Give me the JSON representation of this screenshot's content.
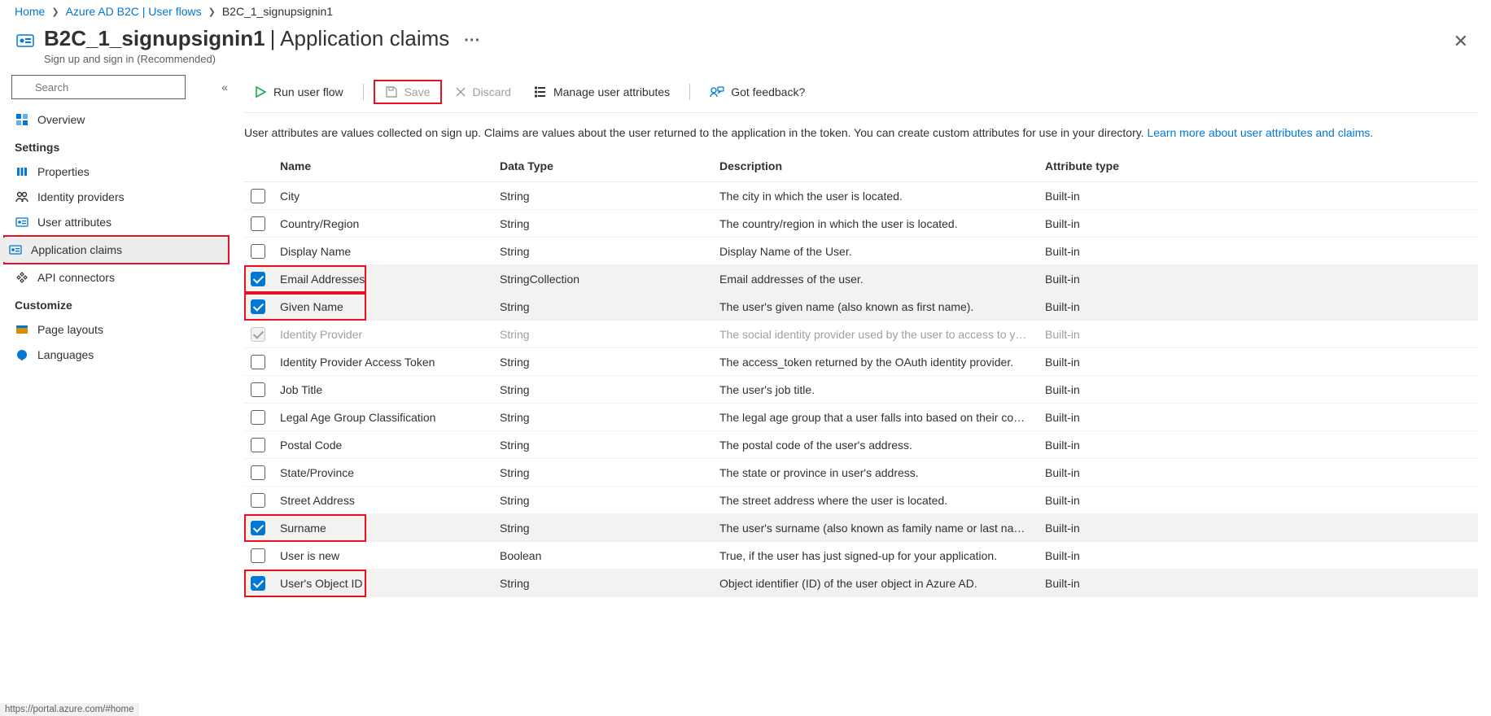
{
  "breadcrumb": {
    "items": [
      "Home",
      "Azure AD B2C | User flows",
      "B2C_1_signupsignin1"
    ]
  },
  "header": {
    "icon_name": "user-flow-icon",
    "title_strong": "B2C_1_signupsignin1",
    "title_sep": " | ",
    "title_thin": "Application claims",
    "ellipsis": "···",
    "subtitle": "Sign up and sign in (Recommended)"
  },
  "sidebar": {
    "search_placeholder": "Search",
    "overview_label": "Overview",
    "groups": [
      {
        "label": "Settings",
        "items": [
          {
            "icon": "properties-icon",
            "label": "Properties"
          },
          {
            "icon": "identity-providers-icon",
            "label": "Identity providers"
          },
          {
            "icon": "user-attributes-icon",
            "label": "User attributes"
          },
          {
            "icon": "application-claims-icon",
            "label": "Application claims",
            "active": true,
            "highlight": true
          },
          {
            "icon": "api-connectors-icon",
            "label": "API connectors"
          }
        ]
      },
      {
        "label": "Customize",
        "items": [
          {
            "icon": "page-layouts-icon",
            "label": "Page layouts"
          },
          {
            "icon": "languages-icon",
            "label": "Languages"
          }
        ]
      }
    ]
  },
  "toolbar": {
    "run_label": "Run user flow",
    "save_label": "Save",
    "discard_label": "Discard",
    "manage_label": "Manage user attributes",
    "feedback_label": "Got feedback?"
  },
  "info": {
    "text": "User attributes are values collected on sign up. Claims are values about the user returned to the application in the token. You can create custom attributes for use in your directory. ",
    "link": "Learn more about user attributes and claims."
  },
  "table": {
    "columns": [
      "Name",
      "Data Type",
      "Description",
      "Attribute type"
    ],
    "rows": [
      {
        "checked": false,
        "name": "City",
        "type": "String",
        "desc": "The city in which the user is located.",
        "attr": "Built-in"
      },
      {
        "checked": false,
        "name": "Country/Region",
        "type": "String",
        "desc": "The country/region in which the user is located.",
        "attr": "Built-in"
      },
      {
        "checked": false,
        "name": "Display Name",
        "type": "String",
        "desc": "Display Name of the User.",
        "attr": "Built-in"
      },
      {
        "checked": true,
        "highlight": true,
        "name": "Email Addresses",
        "type": "StringCollection",
        "desc": "Email addresses of the user.",
        "attr": "Built-in"
      },
      {
        "checked": true,
        "highlight": true,
        "name": "Given Name",
        "type": "String",
        "desc": "The user's given name (also known as first name).",
        "attr": "Built-in"
      },
      {
        "disabled": true,
        "name": "Identity Provider",
        "type": "String",
        "desc": "The social identity provider used by the user to access to yo…",
        "attr": "Built-in"
      },
      {
        "checked": false,
        "name": "Identity Provider Access Token",
        "type": "String",
        "desc": "The access_token returned by the OAuth identity provider.",
        "attr": "Built-in"
      },
      {
        "checked": false,
        "name": "Job Title",
        "type": "String",
        "desc": "The user's job title.",
        "attr": "Built-in"
      },
      {
        "checked": false,
        "name": "Legal Age Group Classification",
        "type": "String",
        "desc": "The legal age group that a user falls into based on their cou…",
        "attr": "Built-in"
      },
      {
        "checked": false,
        "name": "Postal Code",
        "type": "String",
        "desc": "The postal code of the user's address.",
        "attr": "Built-in"
      },
      {
        "checked": false,
        "name": "State/Province",
        "type": "String",
        "desc": "The state or province in user's address.",
        "attr": "Built-in"
      },
      {
        "checked": false,
        "name": "Street Address",
        "type": "String",
        "desc": "The street address where the user is located.",
        "attr": "Built-in"
      },
      {
        "checked": true,
        "highlight": true,
        "name": "Surname",
        "type": "String",
        "desc": "The user's surname (also known as family name or last nam…",
        "attr": "Built-in"
      },
      {
        "checked": false,
        "name": "User is new",
        "type": "Boolean",
        "desc": "True, if the user has just signed-up for your application.",
        "attr": "Built-in"
      },
      {
        "checked": true,
        "highlight": true,
        "name": "User's Object ID",
        "type": "String",
        "desc": "Object identifier (ID) of the user object in Azure AD.",
        "attr": "Built-in"
      }
    ]
  },
  "statusbar": {
    "text": "https://portal.azure.com/#home"
  }
}
